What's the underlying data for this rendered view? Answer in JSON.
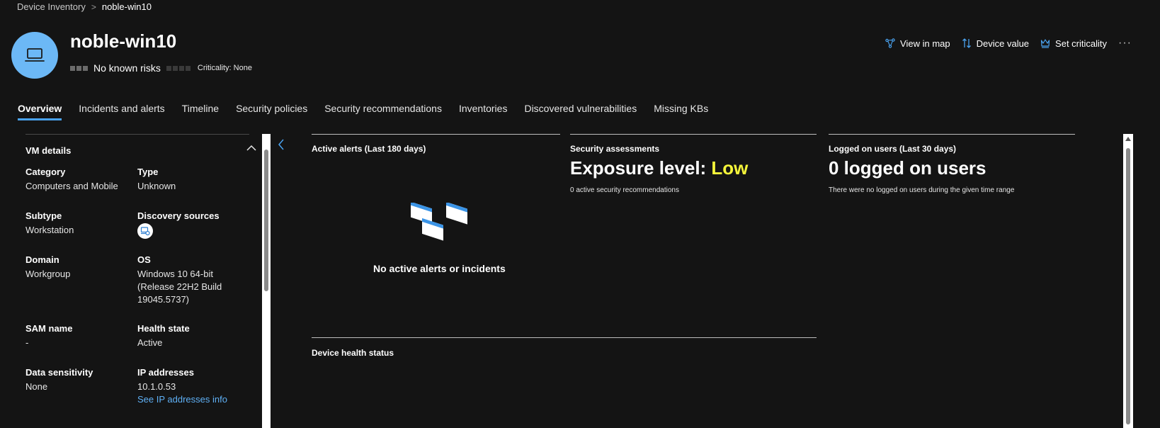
{
  "breadcrumb": {
    "root": "Device Inventory",
    "separator": ">",
    "current": "noble-win10"
  },
  "header": {
    "device_name": "noble-win10",
    "risk_text": "No known risks",
    "criticality_text": "Criticality: None",
    "avatar_icon": "laptop-icon",
    "avatar_color": "#6cb8f6"
  },
  "actions": [
    {
      "label": "View in map",
      "icon": "map-graph-icon"
    },
    {
      "label": "Device value",
      "icon": "sort-arrows-icon"
    },
    {
      "label": "Set criticality",
      "icon": "crown-icon"
    }
  ],
  "more_icon": "···",
  "tabs": [
    {
      "label": "Overview",
      "active": true
    },
    {
      "label": "Incidents and alerts",
      "active": false
    },
    {
      "label": "Timeline",
      "active": false
    },
    {
      "label": "Security policies",
      "active": false
    },
    {
      "label": "Security recommendations",
      "active": false
    },
    {
      "label": "Inventories",
      "active": false
    },
    {
      "label": "Discovered vulnerabilities",
      "active": false
    },
    {
      "label": "Missing KBs",
      "active": false
    }
  ],
  "vm_details": {
    "title": "VM details",
    "fields": {
      "category": {
        "label": "Category",
        "value": "Computers and Mobile"
      },
      "type": {
        "label": "Type",
        "value": "Unknown"
      },
      "subtype": {
        "label": "Subtype",
        "value": "Workstation"
      },
      "discovery": {
        "label": "Discovery sources",
        "icon": "discovery-device-icon"
      },
      "domain": {
        "label": "Domain",
        "value": "Workgroup"
      },
      "os": {
        "label": "OS",
        "line1": "Windows 10 64-bit",
        "line2": "(Release 22H2 Build",
        "line3": "19045.5737)"
      },
      "sam": {
        "label": "SAM name",
        "value": "-"
      },
      "health": {
        "label": "Health state",
        "value": "Active"
      },
      "sensitivity": {
        "label": "Data sensitivity",
        "value": "None"
      },
      "ip": {
        "label": "IP addresses",
        "value": "10.1.0.53",
        "link": "See IP addresses info"
      }
    }
  },
  "cards": {
    "alerts": {
      "title": "Active alerts (Last 180 days)",
      "empty_message": "No active alerts or incidents"
    },
    "security": {
      "title": "Security assessments",
      "exposure_prefix": "Exposure level: ",
      "exposure_value": "Low",
      "exposure_color": "#f5f53a",
      "recommendations": "0 active security recommendations"
    },
    "users": {
      "title": "Logged on users (Last 30 days)",
      "count_text": "0 logged on users",
      "description": "There were no logged on users during the given time range"
    },
    "health": {
      "title": "Device health status"
    }
  },
  "accent_color": "#4aa3f0"
}
